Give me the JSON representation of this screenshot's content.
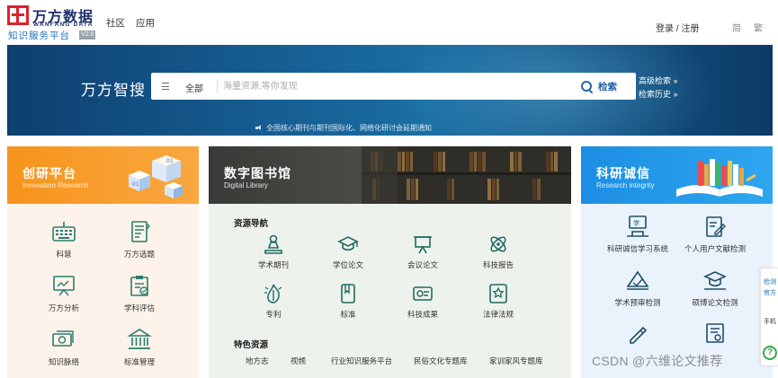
{
  "brand": {
    "name": "万方数据",
    "en": "WANFANG DATA",
    "subtitle": "知识服务平台",
    "version": "V2.0"
  },
  "nav": {
    "community": "社区",
    "apps": "应用",
    "auth": "登录 / 注册",
    "lang_simplified": "简",
    "lang_traditional": "繁"
  },
  "banner": {
    "title": "万方智搜",
    "scope": "全部",
    "search_placeholder": "海量资源,等你发现",
    "search_label": "检索",
    "advanced": "高级检索 »",
    "history": "检索历史 »",
    "notice": "全国核心期刊与期刊国际化、网络化研讨会延期通知"
  },
  "innovation": {
    "title": "创研平台",
    "subtitle": "Innovation Research",
    "items": [
      {
        "label": "科慧",
        "icon": "keyboard-icon"
      },
      {
        "label": "万方选题",
        "icon": "document-list-icon"
      },
      {
        "label": "万方分析",
        "icon": "presentation-board-icon"
      },
      {
        "label": "学科评估",
        "icon": "clipboard-check-icon"
      },
      {
        "label": "知识脉络",
        "icon": "money-network-icon"
      },
      {
        "label": "标准管理",
        "icon": "institution-building-icon"
      }
    ]
  },
  "library": {
    "title": "数字图书馆",
    "subtitle": "Digital Library",
    "nav_title": "资源导航",
    "resources": [
      {
        "label": "学术期刊",
        "icon": "journal-stamp-icon"
      },
      {
        "label": "学位论文",
        "icon": "graduation-cap-icon"
      },
      {
        "label": "会议论文",
        "icon": "easel-icon"
      },
      {
        "label": "科技报告",
        "icon": "atom-icon"
      },
      {
        "label": "专利",
        "icon": "patent-lightbulb-icon"
      },
      {
        "label": "标准",
        "icon": "standard-book-icon"
      },
      {
        "label": "科技成果",
        "icon": "award-badge-icon"
      },
      {
        "label": "法律法规",
        "icon": "law-star-icon"
      }
    ],
    "featured_title": "特色资源",
    "featured": [
      "地方志",
      "视频",
      "行业知识服务平台",
      "民俗文化专题库",
      "家训家风专题库"
    ]
  },
  "integrity": {
    "title": "科研诚信",
    "subtitle": "Research integrity",
    "items": [
      {
        "label": "科研诚信学习系统",
        "icon": "study-board-icon"
      },
      {
        "label": "个人用户文献检测",
        "icon": "edit-document-icon"
      },
      {
        "label": "学术预审检测",
        "icon": "open-book-check-icon"
      },
      {
        "label": "硕博论文检测",
        "icon": "mortarboard-check-icon"
      },
      {
        "label": "",
        "icon": "pen-writing-icon"
      },
      {
        "label": "",
        "icon": "certificate-icon"
      }
    ]
  },
  "float_widget": {
    "line1": "检测",
    "line2": "官方",
    "line3": "手机",
    "help": "?"
  },
  "watermark": "CSDN @六维论文推荐",
  "colors": {
    "accent_blue": "#1d6fb8",
    "orange": "#f6941c",
    "sky_blue": "#1c8ee3",
    "dark": "#393a37"
  }
}
